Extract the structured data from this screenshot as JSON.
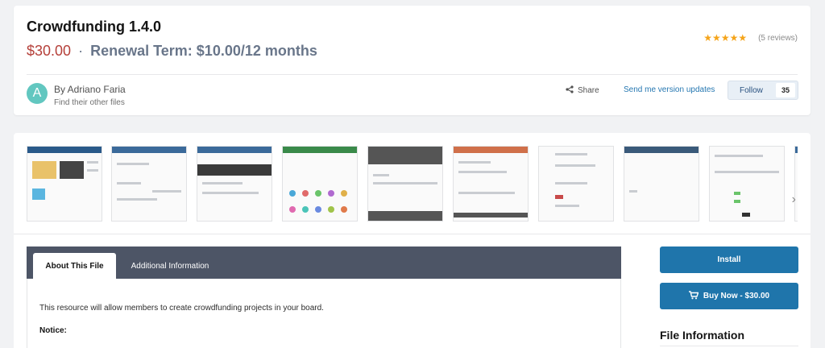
{
  "resource": {
    "title": "Crowdfunding 1.4.0",
    "price": "$30.00",
    "separator": "·",
    "renewal": "Renewal Term: $10.00/12 months",
    "rating": {
      "stars": 5,
      "stars_text": "★★★★★",
      "reviews": "(5 reviews)"
    }
  },
  "author": {
    "avatar_letter": "A",
    "avatar_color": "#62c7c0",
    "byline": "By Adriano Faria",
    "other_files": "Find their other files"
  },
  "actions": {
    "share_icon": "share-icon",
    "share_label": "Share",
    "send_updates": "Send me version updates",
    "follow_label": "Follow",
    "follow_count": "35"
  },
  "gallery": {
    "next_icon": "chevron-right-icon",
    "next_glyph": "›",
    "thumbnails": [
      {
        "name": "screenshot-1"
      },
      {
        "name": "screenshot-2"
      },
      {
        "name": "screenshot-3"
      },
      {
        "name": "screenshot-4"
      },
      {
        "name": "screenshot-5"
      },
      {
        "name": "screenshot-6"
      },
      {
        "name": "screenshot-7"
      },
      {
        "name": "screenshot-8"
      },
      {
        "name": "screenshot-9"
      },
      {
        "name": "screenshot-10"
      }
    ]
  },
  "tabs": [
    {
      "label": "About This File",
      "active": true
    },
    {
      "label": "Additional Information",
      "active": false
    }
  ],
  "about": {
    "description": "This resource will allow members to create crowdfunding projects in your board.",
    "notice": "Notice:"
  },
  "sidebar": {
    "install_label": "Install",
    "buy_icon": "cart-icon",
    "buy_label": "Buy Now - $30.00",
    "file_info_heading": "File Information"
  },
  "colors": {
    "price": "#b5403a",
    "renewal": "#69768a",
    "stars": "#f5a41a",
    "primary_button": "#1f75ab",
    "tabs_bar": "#4d5566",
    "link": "#2577b1"
  }
}
